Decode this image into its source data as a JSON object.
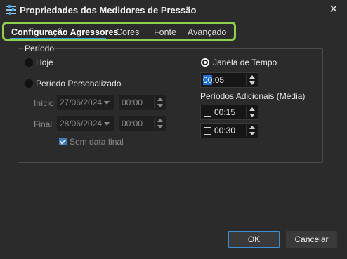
{
  "window": {
    "title": "Propriedades dos Medidores de Pressão",
    "icon": "sliders-icon",
    "close_glyph": "✕"
  },
  "tabs": [
    {
      "label": "Configuração Agressores",
      "active": true
    },
    {
      "label": "Cores",
      "active": false
    },
    {
      "label": "Fonte",
      "active": false
    },
    {
      "label": "Avançado",
      "active": false
    }
  ],
  "period": {
    "group_title": "Período",
    "options": {
      "hoje": "Hoje",
      "personalizado": "Período Personalizado",
      "janela": "Janela de Tempo"
    },
    "selected": "janela",
    "start": {
      "label": "Início",
      "date": "27/06/2024",
      "time": "00:00"
    },
    "end": {
      "label": "Final",
      "date": "28/06/2024",
      "time": "00:00"
    },
    "no_end_date": {
      "label": "Sem data final",
      "checked": true
    },
    "window_time": {
      "selected_part": "00",
      "rest": ":05"
    },
    "additional_periods": {
      "label": "Períodos Adicionais (Média)",
      "items": [
        {
          "value": "00:15",
          "checked": false
        },
        {
          "value": "00:30",
          "checked": false
        }
      ]
    }
  },
  "buttons": {
    "ok": "OK",
    "cancel": "Cancelar"
  },
  "colors": {
    "accent": "#3aa0e0",
    "highlight": "#8fd14f",
    "background": "#2b2b2b"
  }
}
